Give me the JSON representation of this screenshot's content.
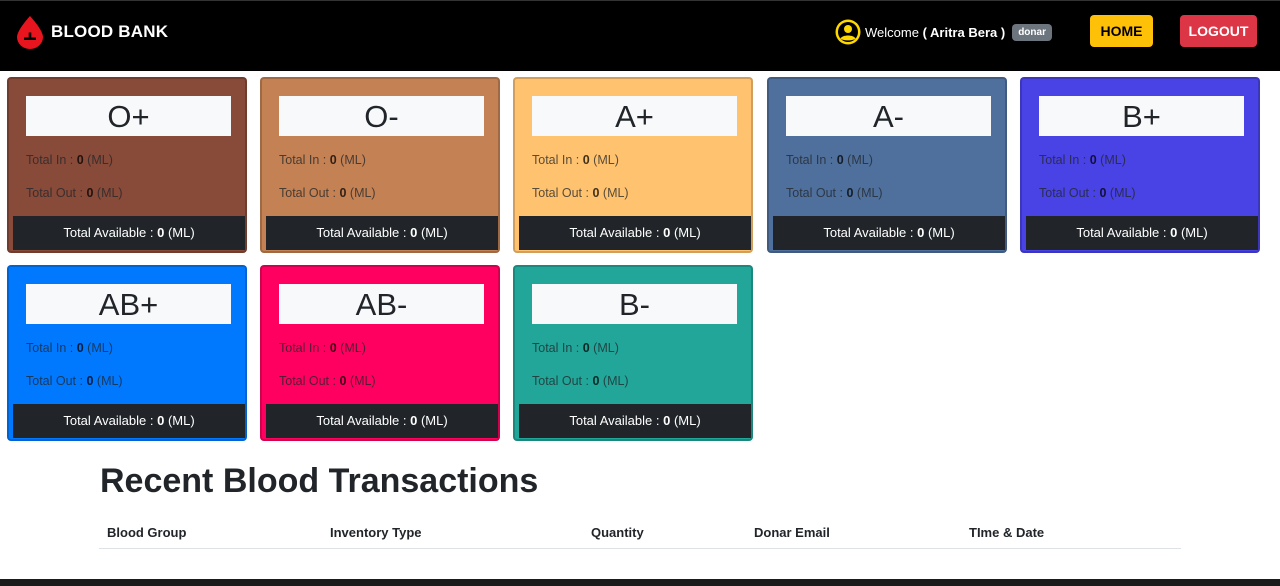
{
  "brand": {
    "name": "BLOOD BANK",
    "logo_icon": "blood-drop-icon"
  },
  "user": {
    "welcome_prefix": "Welcome",
    "name": "( Aritra Bera )",
    "role": "donar",
    "icon": "user-circle-icon"
  },
  "nav": {
    "home_label": "HOME",
    "logout_label": "LOGOUT"
  },
  "labels": {
    "total_in": "Total In :",
    "total_out": "Total Out :",
    "total_available": "Total Available :",
    "unit": "(ML)"
  },
  "cards": [
    {
      "group": "O+",
      "total_in": "0",
      "total_out": "0",
      "available": "0",
      "color": "#884a39"
    },
    {
      "group": "O-",
      "total_in": "0",
      "total_out": "0",
      "available": "0",
      "color": "#c38154"
    },
    {
      "group": "A+",
      "total_in": "0",
      "total_out": "0",
      "available": "0",
      "color": "#ffc26f"
    },
    {
      "group": "A-",
      "total_in": "0",
      "total_out": "0",
      "available": "0",
      "color": "#4f709c"
    },
    {
      "group": "B+",
      "total_in": "0",
      "total_out": "0",
      "available": "0",
      "color": "#4942e4"
    },
    {
      "group": "AB+",
      "total_in": "0",
      "total_out": "0",
      "available": "0",
      "color": "#0079ff"
    },
    {
      "group": "AB-",
      "total_in": "0",
      "total_out": "0",
      "available": "0",
      "color": "#ff0060"
    },
    {
      "group": "B-",
      "total_in": "0",
      "total_out": "0",
      "available": "0",
      "color": "#22a699"
    }
  ],
  "transactions": {
    "title": "Recent Blood Transactions",
    "columns": [
      "Blood Group",
      "Inventory Type",
      "Quantity",
      "Donar Email",
      "TIme & Date"
    ]
  }
}
